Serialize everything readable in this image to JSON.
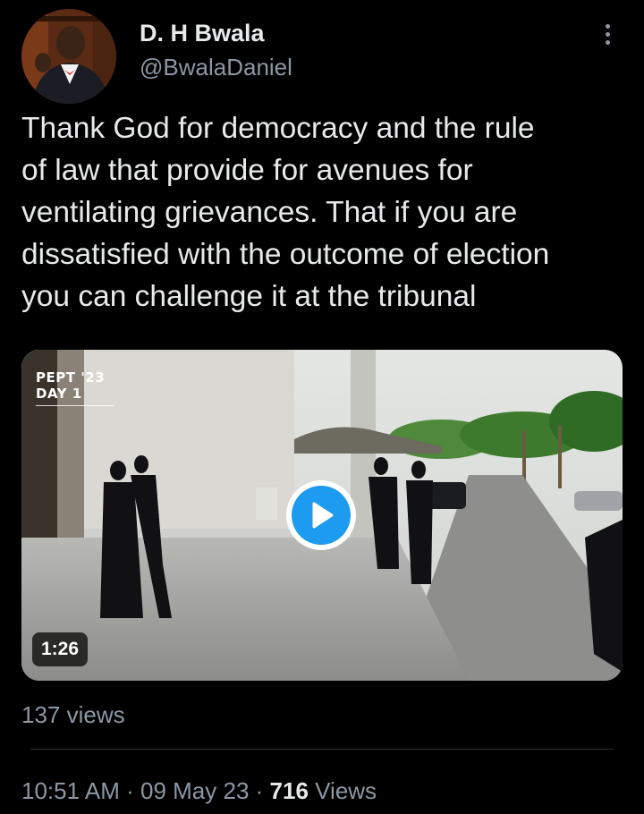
{
  "author": {
    "name": "D. H Bwala",
    "handle": "@BwalaDaniel"
  },
  "tweet": {
    "lines": [
      "Thank God for democracy and the rule",
      "of law that provide for avenues for",
      "ventilating grievances. That if you are",
      "dissatisfied with the outcome of election",
      "you can challenge it at the tribunal"
    ]
  },
  "media": {
    "overlay_line1": "PEPT '23",
    "overlay_line2": "DAY 1",
    "duration": "1:26",
    "views": "137 views"
  },
  "meta": {
    "time": "10:51 AM",
    "separator": "·",
    "date": "09 May 23",
    "views_count": "716",
    "views_label": "Views"
  },
  "colors": {
    "background": "#000000",
    "text_primary": "#e7e9ea",
    "text_secondary": "#8b98a5",
    "accent": "#1d9bf0",
    "divider": "#2f3336"
  },
  "icons": {
    "more": "more-vertical-icon",
    "play": "play-icon"
  }
}
